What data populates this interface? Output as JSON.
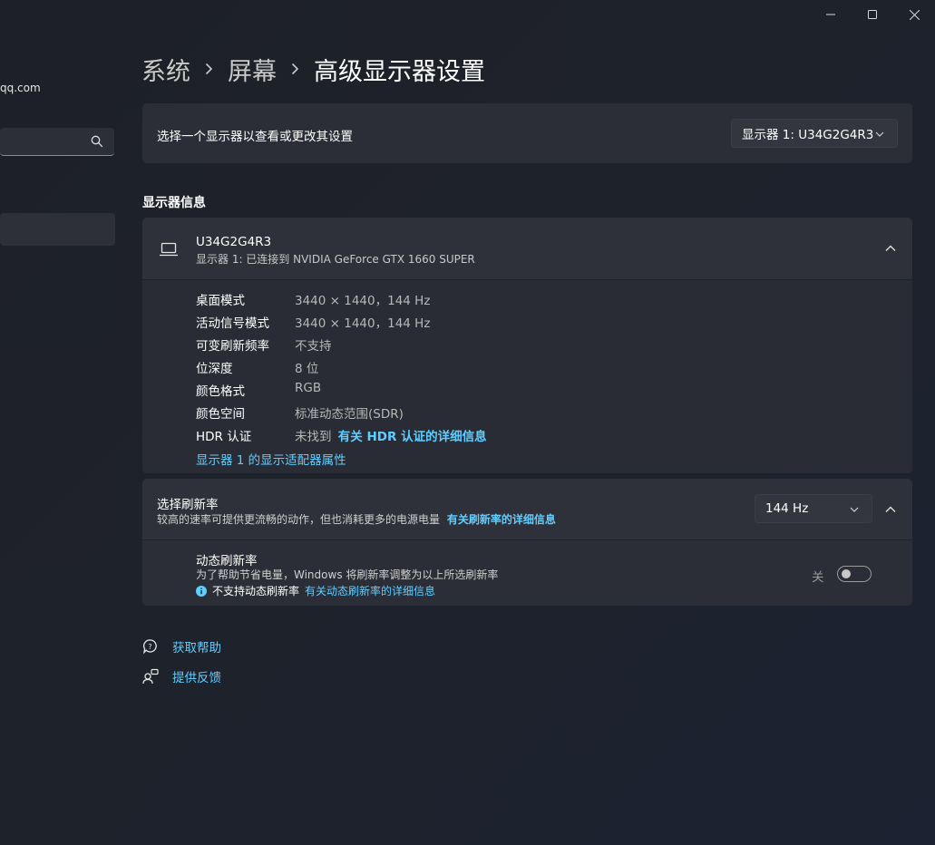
{
  "window": {
    "minimize_icon": "minimize-icon",
    "maximize_icon": "maximize-icon",
    "close_icon": "close-icon"
  },
  "sidebar": {
    "account_email": "qq.com",
    "search_icon": "search-icon"
  },
  "breadcrumb": {
    "items": [
      "系统",
      "屏幕",
      "高级显示器设置"
    ]
  },
  "display_select": {
    "label": "选择一个显示器以查看或更改其设置",
    "selected": "显示器 1: U34G2G4R3"
  },
  "display_info": {
    "section_title": "显示器信息",
    "monitor_name": "U34G2G4R3",
    "monitor_connection": "显示器 1: 已连接到 NVIDIA GeForce GTX 1660 SUPER",
    "rows": [
      {
        "label": "桌面模式",
        "value": "3440 × 1440，144 Hz"
      },
      {
        "label": "活动信号模式",
        "value": "3440 × 1440，144 Hz"
      },
      {
        "label": "可变刷新频率",
        "value": "不支持"
      },
      {
        "label": "位深度",
        "value": "8 位"
      },
      {
        "label": "颜色格式",
        "value": "RGB"
      },
      {
        "label": "颜色空间",
        "value": "标准动态范围(SDR)"
      }
    ],
    "hdr_label": "HDR 认证",
    "hdr_value": "未找到",
    "hdr_link": "有关 HDR 认证的详细信息",
    "adapter_link": "显示器 1 的显示适配器属性"
  },
  "refresh_rate": {
    "title": "选择刷新率",
    "description": "较高的速率可提供更流畅的动作，但也消耗更多的电源电量",
    "link": "有关刷新率的详细信息",
    "selected": "144 Hz",
    "dynamic_title": "动态刷新率",
    "dynamic_desc": "为了帮助节省电量，Windows 将刷新率调整为以上所选刷新率",
    "dynamic_unsupported": "不支持动态刷新率",
    "dynamic_link": "有关动态刷新率的详细信息",
    "toggle_state_label": "关"
  },
  "footer": {
    "help": "获取帮助",
    "feedback": "提供反馈"
  },
  "colors": {
    "accent": "#60cdff",
    "card": "#2b2e36",
    "background": "#1e222b"
  }
}
